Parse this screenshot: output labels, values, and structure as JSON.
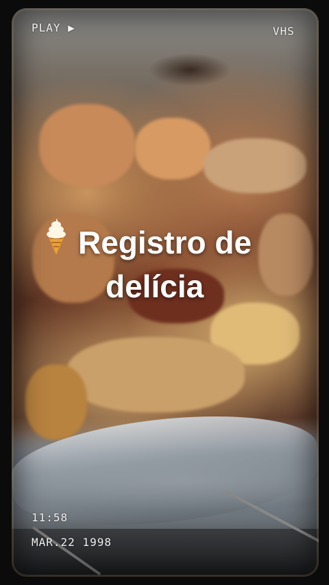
{
  "osd": {
    "play_label": "PLAY ▶",
    "format_label": "VHS",
    "time": "11:58",
    "date": "MAR.22 1998"
  },
  "caption": {
    "line1": "Registro de",
    "line2": "delícia",
    "emoji_icon": "soft-serve-ice-cream-icon"
  }
}
